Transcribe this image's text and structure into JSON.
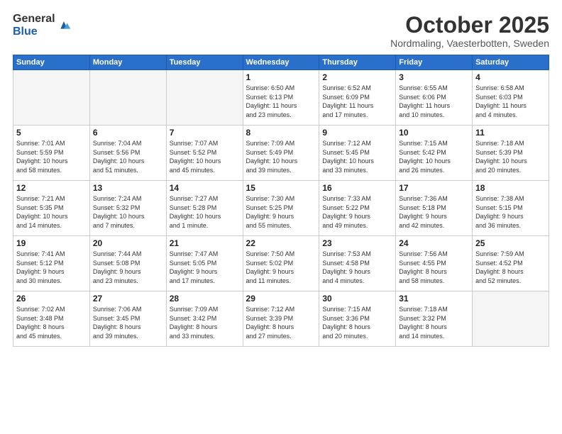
{
  "logo": {
    "general": "General",
    "blue": "Blue"
  },
  "header": {
    "month": "October 2025",
    "location": "Nordmaling, Vaesterbotten, Sweden"
  },
  "weekdays": [
    "Sunday",
    "Monday",
    "Tuesday",
    "Wednesday",
    "Thursday",
    "Friday",
    "Saturday"
  ],
  "weeks": [
    [
      {
        "day": "",
        "info": ""
      },
      {
        "day": "",
        "info": ""
      },
      {
        "day": "",
        "info": ""
      },
      {
        "day": "1",
        "info": "Sunrise: 6:50 AM\nSunset: 6:13 PM\nDaylight: 11 hours\nand 23 minutes."
      },
      {
        "day": "2",
        "info": "Sunrise: 6:52 AM\nSunset: 6:09 PM\nDaylight: 11 hours\nand 17 minutes."
      },
      {
        "day": "3",
        "info": "Sunrise: 6:55 AM\nSunset: 6:06 PM\nDaylight: 11 hours\nand 10 minutes."
      },
      {
        "day": "4",
        "info": "Sunrise: 6:58 AM\nSunset: 6:03 PM\nDaylight: 11 hours\nand 4 minutes."
      }
    ],
    [
      {
        "day": "5",
        "info": "Sunrise: 7:01 AM\nSunset: 5:59 PM\nDaylight: 10 hours\nand 58 minutes."
      },
      {
        "day": "6",
        "info": "Sunrise: 7:04 AM\nSunset: 5:56 PM\nDaylight: 10 hours\nand 51 minutes."
      },
      {
        "day": "7",
        "info": "Sunrise: 7:07 AM\nSunset: 5:52 PM\nDaylight: 10 hours\nand 45 minutes."
      },
      {
        "day": "8",
        "info": "Sunrise: 7:09 AM\nSunset: 5:49 PM\nDaylight: 10 hours\nand 39 minutes."
      },
      {
        "day": "9",
        "info": "Sunrise: 7:12 AM\nSunset: 5:45 PM\nDaylight: 10 hours\nand 33 minutes."
      },
      {
        "day": "10",
        "info": "Sunrise: 7:15 AM\nSunset: 5:42 PM\nDaylight: 10 hours\nand 26 minutes."
      },
      {
        "day": "11",
        "info": "Sunrise: 7:18 AM\nSunset: 5:39 PM\nDaylight: 10 hours\nand 20 minutes."
      }
    ],
    [
      {
        "day": "12",
        "info": "Sunrise: 7:21 AM\nSunset: 5:35 PM\nDaylight: 10 hours\nand 14 minutes."
      },
      {
        "day": "13",
        "info": "Sunrise: 7:24 AM\nSunset: 5:32 PM\nDaylight: 10 hours\nand 7 minutes."
      },
      {
        "day": "14",
        "info": "Sunrise: 7:27 AM\nSunset: 5:28 PM\nDaylight: 10 hours\nand 1 minute."
      },
      {
        "day": "15",
        "info": "Sunrise: 7:30 AM\nSunset: 5:25 PM\nDaylight: 9 hours\nand 55 minutes."
      },
      {
        "day": "16",
        "info": "Sunrise: 7:33 AM\nSunset: 5:22 PM\nDaylight: 9 hours\nand 49 minutes."
      },
      {
        "day": "17",
        "info": "Sunrise: 7:36 AM\nSunset: 5:18 PM\nDaylight: 9 hours\nand 42 minutes."
      },
      {
        "day": "18",
        "info": "Sunrise: 7:38 AM\nSunset: 5:15 PM\nDaylight: 9 hours\nand 36 minutes."
      }
    ],
    [
      {
        "day": "19",
        "info": "Sunrise: 7:41 AM\nSunset: 5:12 PM\nDaylight: 9 hours\nand 30 minutes."
      },
      {
        "day": "20",
        "info": "Sunrise: 7:44 AM\nSunset: 5:08 PM\nDaylight: 9 hours\nand 23 minutes."
      },
      {
        "day": "21",
        "info": "Sunrise: 7:47 AM\nSunset: 5:05 PM\nDaylight: 9 hours\nand 17 minutes."
      },
      {
        "day": "22",
        "info": "Sunrise: 7:50 AM\nSunset: 5:02 PM\nDaylight: 9 hours\nand 11 minutes."
      },
      {
        "day": "23",
        "info": "Sunrise: 7:53 AM\nSunset: 4:58 PM\nDaylight: 9 hours\nand 4 minutes."
      },
      {
        "day": "24",
        "info": "Sunrise: 7:56 AM\nSunset: 4:55 PM\nDaylight: 8 hours\nand 58 minutes."
      },
      {
        "day": "25",
        "info": "Sunrise: 7:59 AM\nSunset: 4:52 PM\nDaylight: 8 hours\nand 52 minutes."
      }
    ],
    [
      {
        "day": "26",
        "info": "Sunrise: 7:02 AM\nSunset: 3:48 PM\nDaylight: 8 hours\nand 45 minutes."
      },
      {
        "day": "27",
        "info": "Sunrise: 7:06 AM\nSunset: 3:45 PM\nDaylight: 8 hours\nand 39 minutes."
      },
      {
        "day": "28",
        "info": "Sunrise: 7:09 AM\nSunset: 3:42 PM\nDaylight: 8 hours\nand 33 minutes."
      },
      {
        "day": "29",
        "info": "Sunrise: 7:12 AM\nSunset: 3:39 PM\nDaylight: 8 hours\nand 27 minutes."
      },
      {
        "day": "30",
        "info": "Sunrise: 7:15 AM\nSunset: 3:36 PM\nDaylight: 8 hours\nand 20 minutes."
      },
      {
        "day": "31",
        "info": "Sunrise: 7:18 AM\nSunset: 3:32 PM\nDaylight: 8 hours\nand 14 minutes."
      },
      {
        "day": "",
        "info": ""
      }
    ]
  ]
}
